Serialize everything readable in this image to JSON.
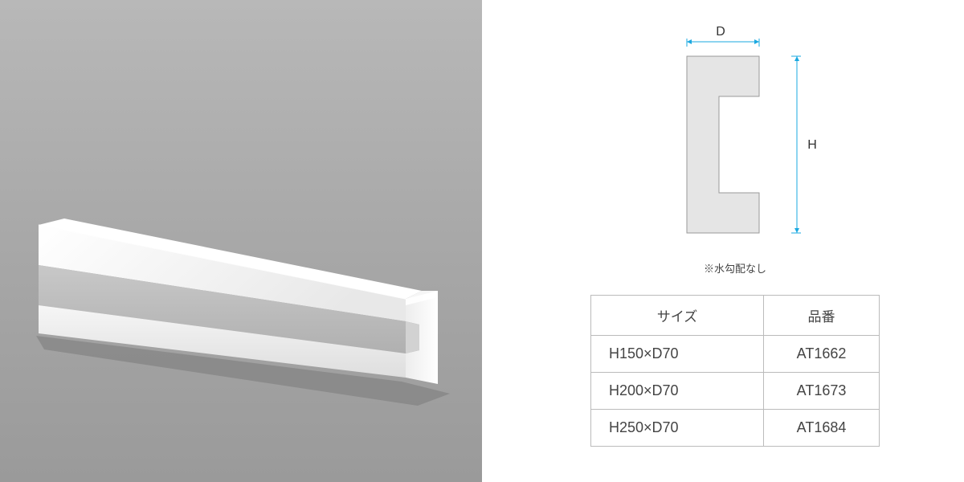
{
  "diagram": {
    "label_d": "D",
    "label_h": "H",
    "note": "※水勾配なし"
  },
  "table": {
    "headers": {
      "size": "サイズ",
      "code": "品番"
    },
    "rows": [
      {
        "size": "H150×D70",
        "code": "AT1662"
      },
      {
        "size": "H200×D70",
        "code": "AT1673"
      },
      {
        "size": "H250×D70",
        "code": "AT1684"
      }
    ]
  }
}
